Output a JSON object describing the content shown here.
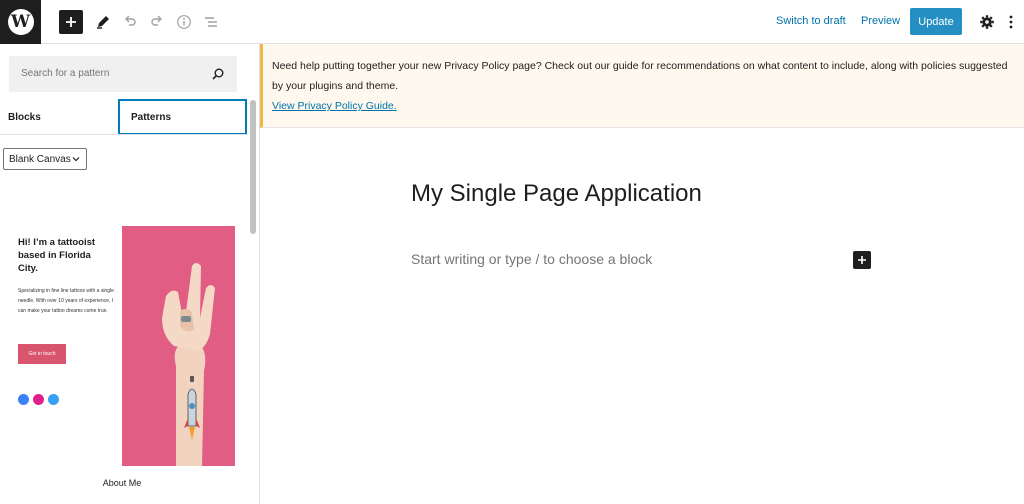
{
  "toolbar": {
    "logo_letter": "W",
    "switch_to_draft": "Switch to draft",
    "preview": "Preview",
    "update": "Update",
    "icons": [
      "add-block-icon",
      "pencil-icon",
      "undo-icon",
      "redo-icon",
      "info-icon",
      "list-view-icon",
      "gear-icon",
      "more-vertical-icon"
    ]
  },
  "sidebar": {
    "search_placeholder": "Search for a pattern",
    "tabs": [
      {
        "label": "Blocks",
        "active": false
      },
      {
        "label": "Patterns",
        "active": true
      }
    ],
    "category_selected": "Blank Canvas",
    "pattern": {
      "heading": "Hi! I’m a tattooist based in Florida City.",
      "body": "Specializing in fine line tattoos with a single needle. With over 10 years of experience, I can make your tattoo dreams come true.",
      "button": "Get in touch",
      "caption": "About Me",
      "social_colors": [
        "#3b82f6",
        "#e0218a",
        "#38a1f3"
      ]
    }
  },
  "editor": {
    "notice_text": "Need help putting together your new Privacy Policy page? Check out our guide for recommendations on what content to include, along with policies suggested by your plugins and theme.",
    "notice_link": "View Privacy Policy Guide.",
    "page_title": "My Single Page Application",
    "block_placeholder": "Start writing or type / to choose a block"
  },
  "colors": {
    "accent": "#007cba",
    "link": "#0073aa",
    "notice_border": "#f0b849",
    "pattern_pink": "#e25d83"
  }
}
